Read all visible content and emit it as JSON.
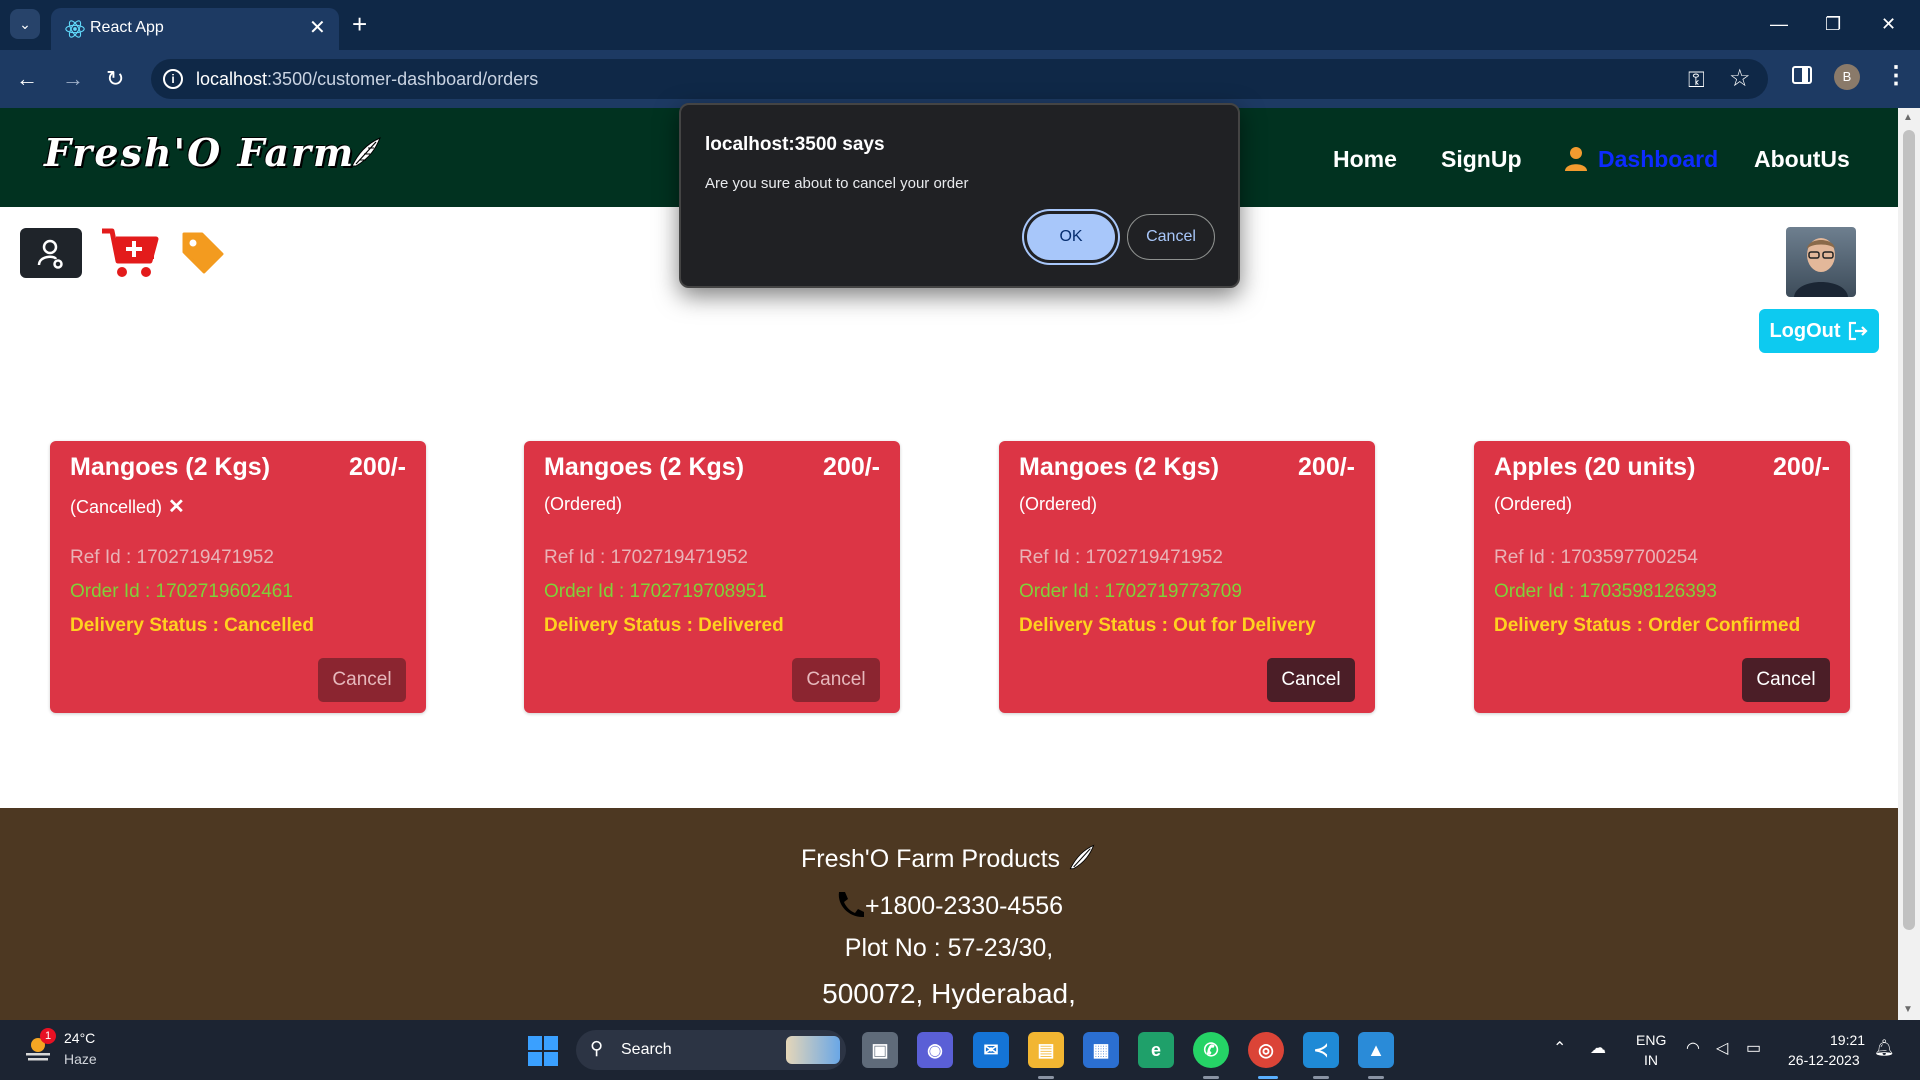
{
  "browser": {
    "tab_title": "React App",
    "url_host": "localhost",
    "url_rest": ":3500/customer-dashboard/orders"
  },
  "site": {
    "logo_text": "Fresh'O Farm",
    "nav": {
      "home": "Home",
      "signup": "SignUp",
      "dashboard": "Dashboard",
      "aboutus": "AboutUs"
    },
    "logout_label": "LogOut"
  },
  "orders": [
    {
      "product": "Mangoes (2 Kgs)",
      "price": "200/-",
      "status": "(Cancelled)",
      "ref": "Ref Id : 1702719471952",
      "order_id": "Order Id : 1702719602461",
      "delivery": "Delivery Status : Cancelled",
      "cancel_label": "Cancel",
      "cancel_enabled": false
    },
    {
      "product": "Mangoes (2 Kgs)",
      "price": "200/-",
      "status": "(Ordered)",
      "ref": "Ref Id : 1702719471952",
      "order_id": "Order Id : 1702719708951",
      "delivery": "Delivery Status : Delivered",
      "cancel_label": "Cancel",
      "cancel_enabled": false
    },
    {
      "product": "Mangoes (2 Kgs)",
      "price": "200/-",
      "status": "(Ordered)",
      "ref": "Ref Id : 1702719471952",
      "order_id": "Order Id : 1702719773709",
      "delivery": "Delivery Status : Out for Delivery",
      "cancel_label": "Cancel",
      "cancel_enabled": true
    },
    {
      "product": "Apples (20 units)",
      "price": "200/-",
      "status": "(Ordered)",
      "ref": "Ref Id : 1703597700254",
      "order_id": "Order Id : 1703598126393",
      "delivery": "Delivery Status : Order Confirmed",
      "cancel_label": "Cancel",
      "cancel_enabled": true
    }
  ],
  "footer": {
    "company": "Fresh'O Farm Products",
    "phone": "+1800-2330-4556",
    "address1": "Plot No : 57-23/30,",
    "address2": "500072, Hyderabad,"
  },
  "dialog": {
    "title": "localhost:3500 says",
    "message": "Are you sure about to cancel your order",
    "ok_label": "OK",
    "cancel_label": "Cancel"
  },
  "taskbar": {
    "weather_badge": "1",
    "temperature": "24°C",
    "weather": "Haze",
    "search_label": "Search",
    "lang_line1": "ENG",
    "lang_line2": "IN",
    "time": "19:21",
    "date": "26-12-2023",
    "profile_initial": "B"
  },
  "colors": {
    "header_bg": "#013220",
    "card_bg": "#dc3545",
    "footer_bg": "#4d3822",
    "logout_bg": "#0dcaf0",
    "delivery_text": "#ffd21f",
    "order_id_text": "#7fd13a"
  }
}
